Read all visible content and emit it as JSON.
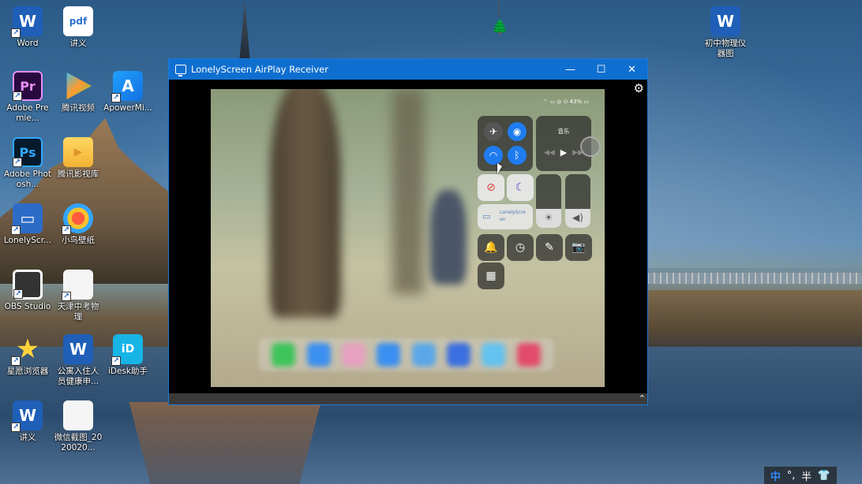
{
  "desktop": {
    "icons_left_col1": [
      {
        "name": "word",
        "label": "Word",
        "glyph": "W"
      },
      {
        "name": "adobe-premiere",
        "label": "Adobe Premie...",
        "glyph": "Pr"
      },
      {
        "name": "adobe-photoshop",
        "label": "Adobe Photosh...",
        "glyph": "Ps"
      },
      {
        "name": "lonelyscreen",
        "label": "LonelyScr...",
        "glyph": "▭"
      },
      {
        "name": "obs-studio",
        "label": "OBS Studio",
        "glyph": "●"
      },
      {
        "name": "xingyuan-browser",
        "label": "星愿浏览器",
        "glyph": "★"
      },
      {
        "name": "jiangyi-doc",
        "label": "讲义",
        "glyph": "W"
      }
    ],
    "icons_left_col2": [
      {
        "name": "jiangyi-pdf",
        "label": "讲义",
        "glyph": "pdf"
      },
      {
        "name": "tencent-video",
        "label": "腾讯视频",
        "glyph": ""
      },
      {
        "name": "tencent-video-library",
        "label": "腾讯影视库",
        "glyph": "▶"
      },
      {
        "name": "xiaoniao-wallpaper",
        "label": "小鸟壁纸",
        "glyph": ""
      },
      {
        "name": "tianjin-physics",
        "label": "天津中考物理",
        "glyph": "📄"
      },
      {
        "name": "apartment-health-form",
        "label": "公寓入住人员健康申...",
        "glyph": "W"
      },
      {
        "name": "wechat-screenshot",
        "label": "微信截图_2020020...",
        "glyph": "📄"
      }
    ],
    "icons_left_col3": [
      {
        "name": "apowermirror",
        "label": "ApowerMi...",
        "glyph": "A"
      },
      {
        "name": "idesk",
        "label": "iDesk助手",
        "glyph": "iD"
      }
    ],
    "icon_right": {
      "name": "physics-instruments-doc",
      "label": "初中物理仪器图",
      "glyph": "W"
    }
  },
  "window": {
    "title": "LonelyScreen AirPlay Receiver",
    "minimize": "—",
    "maximize": "☐",
    "close": "✕",
    "settings": "⚙",
    "expand": "⌃"
  },
  "ipad": {
    "status_bar": "⌔ ▭ ◎ ⊙ 43% ▭",
    "control_center": {
      "music_title": "音乐",
      "play": "▶",
      "prev": "◀◀",
      "next": "▶▶",
      "airplane": "✈",
      "cellular": "◉",
      "wifi": "◠",
      "bluetooth": "ᛒ",
      "rotation_lock": "⊘",
      "do_not_disturb": "☾",
      "screen_mirroring": "LonelyScre en",
      "brightness_glyph": "☀",
      "volume_glyph": "◀)",
      "bell": "🔔",
      "timer": "◷",
      "notes": "✎",
      "camera": "📷",
      "qr": "▦",
      "brightness_level": 0.35,
      "volume_level": 0.35
    }
  },
  "tray": {
    "ime": "中",
    "punct": "°,",
    "width": "半",
    "skin": "👕"
  }
}
